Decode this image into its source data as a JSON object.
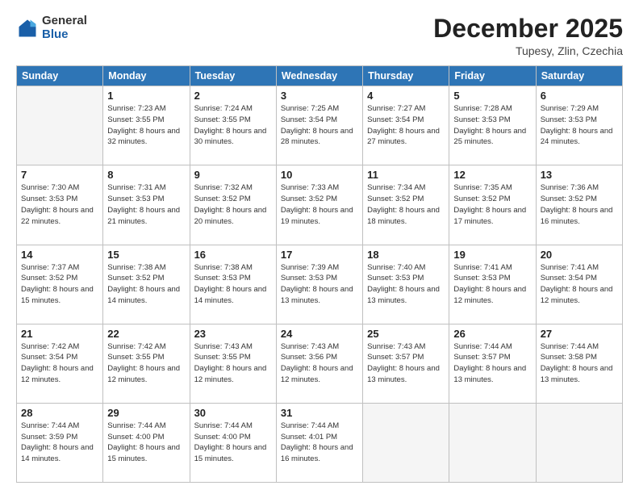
{
  "header": {
    "logo": {
      "general": "General",
      "blue": "Blue"
    },
    "title": "December 2025",
    "location": "Tupesy, Zlin, Czechia"
  },
  "weekdays": [
    "Sunday",
    "Monday",
    "Tuesday",
    "Wednesday",
    "Thursday",
    "Friday",
    "Saturday"
  ],
  "weeks": [
    [
      {
        "day": "",
        "empty": true
      },
      {
        "day": "1",
        "sunrise": "Sunrise: 7:23 AM",
        "sunset": "Sunset: 3:55 PM",
        "daylight": "Daylight: 8 hours and 32 minutes."
      },
      {
        "day": "2",
        "sunrise": "Sunrise: 7:24 AM",
        "sunset": "Sunset: 3:55 PM",
        "daylight": "Daylight: 8 hours and 30 minutes."
      },
      {
        "day": "3",
        "sunrise": "Sunrise: 7:25 AM",
        "sunset": "Sunset: 3:54 PM",
        "daylight": "Daylight: 8 hours and 28 minutes."
      },
      {
        "day": "4",
        "sunrise": "Sunrise: 7:27 AM",
        "sunset": "Sunset: 3:54 PM",
        "daylight": "Daylight: 8 hours and 27 minutes."
      },
      {
        "day": "5",
        "sunrise": "Sunrise: 7:28 AM",
        "sunset": "Sunset: 3:53 PM",
        "daylight": "Daylight: 8 hours and 25 minutes."
      },
      {
        "day": "6",
        "sunrise": "Sunrise: 7:29 AM",
        "sunset": "Sunset: 3:53 PM",
        "daylight": "Daylight: 8 hours and 24 minutes."
      }
    ],
    [
      {
        "day": "7",
        "sunrise": "Sunrise: 7:30 AM",
        "sunset": "Sunset: 3:53 PM",
        "daylight": "Daylight: 8 hours and 22 minutes."
      },
      {
        "day": "8",
        "sunrise": "Sunrise: 7:31 AM",
        "sunset": "Sunset: 3:53 PM",
        "daylight": "Daylight: 8 hours and 21 minutes."
      },
      {
        "day": "9",
        "sunrise": "Sunrise: 7:32 AM",
        "sunset": "Sunset: 3:52 PM",
        "daylight": "Daylight: 8 hours and 20 minutes."
      },
      {
        "day": "10",
        "sunrise": "Sunrise: 7:33 AM",
        "sunset": "Sunset: 3:52 PM",
        "daylight": "Daylight: 8 hours and 19 minutes."
      },
      {
        "day": "11",
        "sunrise": "Sunrise: 7:34 AM",
        "sunset": "Sunset: 3:52 PM",
        "daylight": "Daylight: 8 hours and 18 minutes."
      },
      {
        "day": "12",
        "sunrise": "Sunrise: 7:35 AM",
        "sunset": "Sunset: 3:52 PM",
        "daylight": "Daylight: 8 hours and 17 minutes."
      },
      {
        "day": "13",
        "sunrise": "Sunrise: 7:36 AM",
        "sunset": "Sunset: 3:52 PM",
        "daylight": "Daylight: 8 hours and 16 minutes."
      }
    ],
    [
      {
        "day": "14",
        "sunrise": "Sunrise: 7:37 AM",
        "sunset": "Sunset: 3:52 PM",
        "daylight": "Daylight: 8 hours and 15 minutes."
      },
      {
        "day": "15",
        "sunrise": "Sunrise: 7:38 AM",
        "sunset": "Sunset: 3:52 PM",
        "daylight": "Daylight: 8 hours and 14 minutes."
      },
      {
        "day": "16",
        "sunrise": "Sunrise: 7:38 AM",
        "sunset": "Sunset: 3:53 PM",
        "daylight": "Daylight: 8 hours and 14 minutes."
      },
      {
        "day": "17",
        "sunrise": "Sunrise: 7:39 AM",
        "sunset": "Sunset: 3:53 PM",
        "daylight": "Daylight: 8 hours and 13 minutes."
      },
      {
        "day": "18",
        "sunrise": "Sunrise: 7:40 AM",
        "sunset": "Sunset: 3:53 PM",
        "daylight": "Daylight: 8 hours and 13 minutes."
      },
      {
        "day": "19",
        "sunrise": "Sunrise: 7:41 AM",
        "sunset": "Sunset: 3:53 PM",
        "daylight": "Daylight: 8 hours and 12 minutes."
      },
      {
        "day": "20",
        "sunrise": "Sunrise: 7:41 AM",
        "sunset": "Sunset: 3:54 PM",
        "daylight": "Daylight: 8 hours and 12 minutes."
      }
    ],
    [
      {
        "day": "21",
        "sunrise": "Sunrise: 7:42 AM",
        "sunset": "Sunset: 3:54 PM",
        "daylight": "Daylight: 8 hours and 12 minutes."
      },
      {
        "day": "22",
        "sunrise": "Sunrise: 7:42 AM",
        "sunset": "Sunset: 3:55 PM",
        "daylight": "Daylight: 8 hours and 12 minutes."
      },
      {
        "day": "23",
        "sunrise": "Sunrise: 7:43 AM",
        "sunset": "Sunset: 3:55 PM",
        "daylight": "Daylight: 8 hours and 12 minutes."
      },
      {
        "day": "24",
        "sunrise": "Sunrise: 7:43 AM",
        "sunset": "Sunset: 3:56 PM",
        "daylight": "Daylight: 8 hours and 12 minutes."
      },
      {
        "day": "25",
        "sunrise": "Sunrise: 7:43 AM",
        "sunset": "Sunset: 3:57 PM",
        "daylight": "Daylight: 8 hours and 13 minutes."
      },
      {
        "day": "26",
        "sunrise": "Sunrise: 7:44 AM",
        "sunset": "Sunset: 3:57 PM",
        "daylight": "Daylight: 8 hours and 13 minutes."
      },
      {
        "day": "27",
        "sunrise": "Sunrise: 7:44 AM",
        "sunset": "Sunset: 3:58 PM",
        "daylight": "Daylight: 8 hours and 13 minutes."
      }
    ],
    [
      {
        "day": "28",
        "sunrise": "Sunrise: 7:44 AM",
        "sunset": "Sunset: 3:59 PM",
        "daylight": "Daylight: 8 hours and 14 minutes."
      },
      {
        "day": "29",
        "sunrise": "Sunrise: 7:44 AM",
        "sunset": "Sunset: 4:00 PM",
        "daylight": "Daylight: 8 hours and 15 minutes."
      },
      {
        "day": "30",
        "sunrise": "Sunrise: 7:44 AM",
        "sunset": "Sunset: 4:00 PM",
        "daylight": "Daylight: 8 hours and 15 minutes."
      },
      {
        "day": "31",
        "sunrise": "Sunrise: 7:44 AM",
        "sunset": "Sunset: 4:01 PM",
        "daylight": "Daylight: 8 hours and 16 minutes."
      },
      {
        "day": "",
        "empty": true
      },
      {
        "day": "",
        "empty": true
      },
      {
        "day": "",
        "empty": true
      }
    ]
  ]
}
